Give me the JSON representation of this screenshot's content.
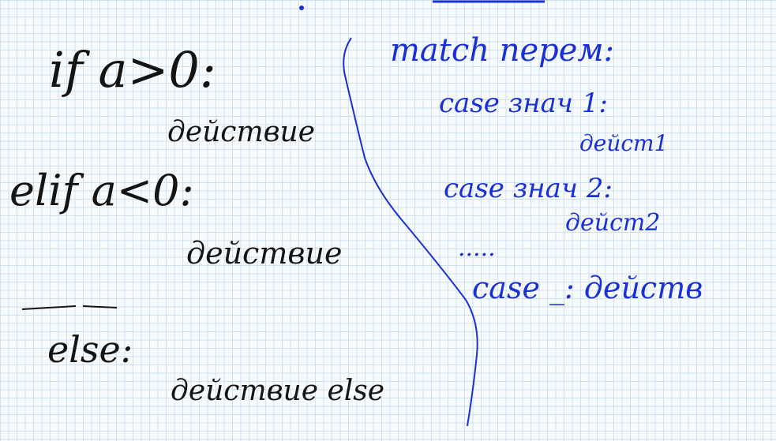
{
  "left": {
    "line1": "if a>0:",
    "line2": "действие",
    "line3": "elif a<0:",
    "line4": "действие",
    "line5": "else:",
    "line6": "действие else"
  },
  "right": {
    "line1": "match перем:",
    "line2": "case знач 1:",
    "line3": "дейст1",
    "line4": "case знач 2:",
    "line5": "дейст2",
    "line6": ".....",
    "line7": "case _: действ"
  }
}
